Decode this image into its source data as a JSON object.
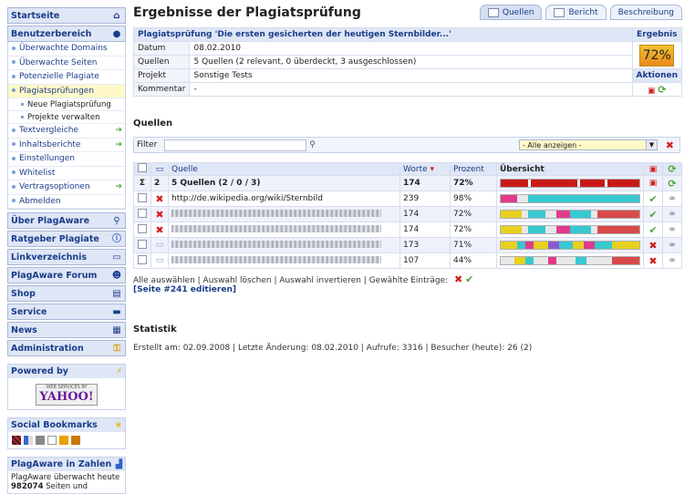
{
  "sidebar": {
    "start": "Startseite",
    "user_area": "Benutzerbereich",
    "user_items": [
      "Überwachte Domains",
      "Überwachte Seiten",
      "Potenzielle Plagiate",
      "Plagiatsprüfungen"
    ],
    "sub_items": [
      "Neue Plagiatsprüfung",
      "Projekte verwalten"
    ],
    "more_items": [
      "Textvergleiche",
      "Inhaltsberichte",
      "Einstellungen",
      "Whitelist",
      "Vertragsoptionen",
      "Abmelden"
    ],
    "sections": [
      "Über PlagAware",
      "Ratgeber Plagiate",
      "Linkverzeichnis",
      "PlagAware Forum",
      "Shop",
      "Service",
      "News",
      "Administration"
    ],
    "powered_by": "Powered by",
    "yahoo_top": "WEB SERVICES BY",
    "yahoo": "YAHOO!",
    "social": "Social Bookmarks",
    "zahlen": "PlagAware in Zahlen",
    "zahlen_text1": "PlagAware überwacht heute",
    "zahlen_num": "982074",
    "zahlen_text2": "Seiten und"
  },
  "main": {
    "title": "Ergebnisse der Plagiatsprüfung",
    "tabs": [
      "Quellen",
      "Bericht",
      "Beschreibung"
    ],
    "info_title": "Plagiatsprüfung 'Die ersten gesicherten der heutigen Sternbilder...'",
    "ergebnis": "Ergebnis",
    "percent": "72%",
    "aktionen": "Aktionen",
    "rows": [
      {
        "label": "Datum",
        "value": "08.02.2010"
      },
      {
        "label": "Quellen",
        "value": "5 Quellen (2 relevant, 0 überdeckt, 3 ausgeschlossen)"
      },
      {
        "label": "Projekt",
        "value": "Sonstige Tests"
      },
      {
        "label": "Kommentar",
        "value": "-"
      }
    ],
    "quellen_title": "Quellen",
    "filter_label": "Filter",
    "filter_select": "- Alle anzeigen -",
    "table_headers": {
      "quelle": "Quelle",
      "worte": "Worte",
      "prozent": "Prozent",
      "uebersicht": "Übersicht"
    },
    "summary": {
      "count": "2",
      "text": "5 Quellen (2 / 0 / 3)",
      "words": "174",
      "pct": "72%"
    },
    "sources": [
      {
        "url": "http://de.wikipedia.org/wiki/Sternbild",
        "words": "239",
        "pct": "98%"
      },
      {
        "url": "",
        "words": "174",
        "pct": "72%"
      },
      {
        "url": "",
        "words": "174",
        "pct": "72%"
      },
      {
        "url": "",
        "words": "173",
        "pct": "71%"
      },
      {
        "url": "",
        "words": "107",
        "pct": "44%"
      }
    ],
    "links_line": "Alle auswählen | Auswahl löschen | Auswahl invertieren | Gewählte Einträge:",
    "edit_link": "[Seite #241 editieren]",
    "statistik_title": "Statistik",
    "statistik": "Erstellt am: 02.09.2008 | Letzte Änderung: 08.02.2010 | Aufrufe: 3316 | Besucher (heute): 26 (2)"
  }
}
